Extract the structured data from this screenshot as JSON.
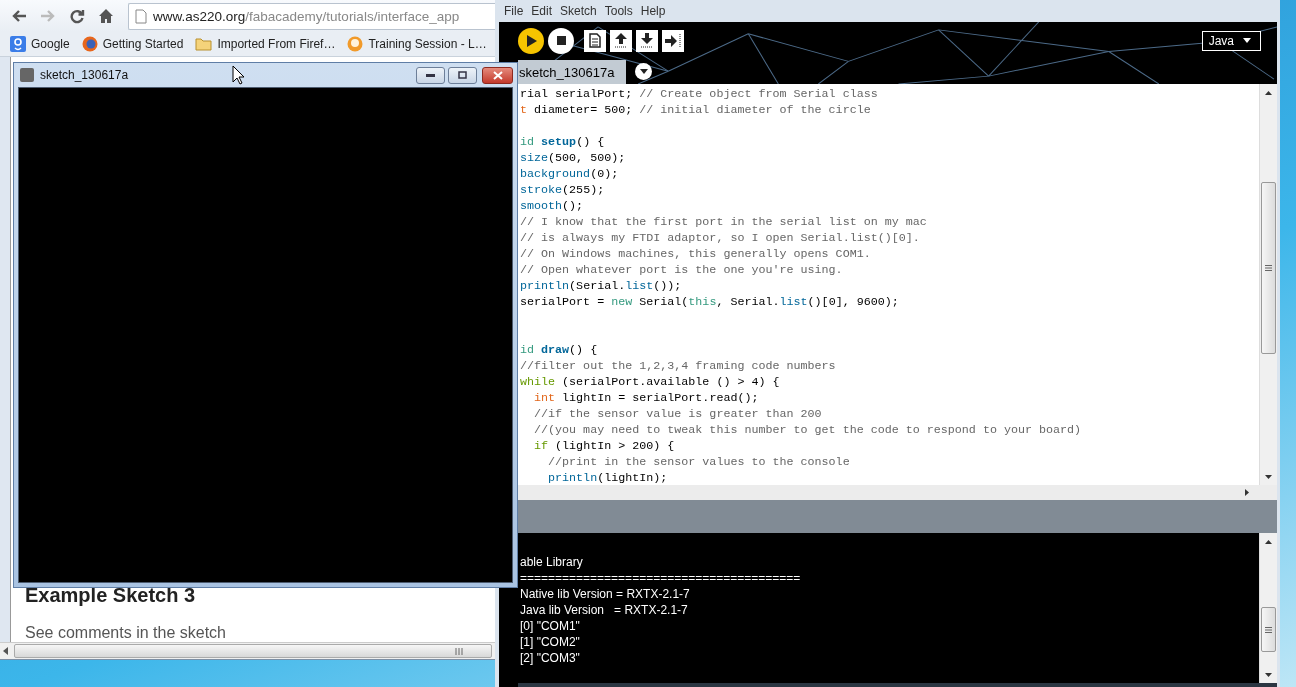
{
  "browser": {
    "nav_buttons": [
      {
        "kind": "back",
        "disabled": false
      },
      {
        "kind": "forward",
        "disabled": true
      },
      {
        "kind": "reload",
        "disabled": false
      },
      {
        "kind": "home",
        "disabled": false
      }
    ],
    "url_host": "www.as220.org",
    "url_path": "/fabacademy/tutorials/interface_app",
    "bookmarks": [
      {
        "kind": "google",
        "label": "Google"
      },
      {
        "kind": "firefox",
        "label": "Getting Started"
      },
      {
        "kind": "folder",
        "label": "Imported From Firef…"
      },
      {
        "kind": "session",
        "label": "Training Session - L…"
      }
    ],
    "page": {
      "heading": "Example Sketch 3",
      "paragraph": "See comments in the sketch"
    }
  },
  "sketch_window": {
    "title": "sketch_130617a"
  },
  "ide": {
    "menu": [
      "File",
      "Edit",
      "Sketch",
      "Tools",
      "Help"
    ],
    "mode": "Java",
    "tabs": [
      {
        "label": "sketch_130617a",
        "selected": true
      }
    ],
    "code": [
      {
        "kind": "code",
        "segs": [
          {
            "t": "rial serialPort; ",
            "kind": "plain"
          },
          {
            "t": "// Create object from Serial class",
            "kind": "comment"
          }
        ]
      },
      {
        "kind": "code",
        "segs": [
          {
            "t": "t",
            "kind": "type"
          },
          {
            "t": " diameter= 500; ",
            "kind": "plain"
          },
          {
            "t": "// initial diameter of the circle",
            "kind": "comment"
          }
        ]
      },
      {
        "kind": "blank"
      },
      {
        "kind": "code",
        "segs": [
          {
            "t": "id ",
            "kind": "kw"
          },
          {
            "t": "setup",
            "kind": "def"
          },
          {
            "t": "() {",
            "kind": "plain"
          }
        ]
      },
      {
        "kind": "code",
        "segs": [
          {
            "t": "size",
            "kind": "fn"
          },
          {
            "t": "(500, 500);",
            "kind": "plain"
          }
        ]
      },
      {
        "kind": "code",
        "segs": [
          {
            "t": "background",
            "kind": "fn"
          },
          {
            "t": "(0);",
            "kind": "plain"
          }
        ]
      },
      {
        "kind": "code",
        "segs": [
          {
            "t": "stroke",
            "kind": "fn"
          },
          {
            "t": "(255);",
            "kind": "plain"
          }
        ]
      },
      {
        "kind": "code",
        "segs": [
          {
            "t": "smooth",
            "kind": "fn"
          },
          {
            "t": "();",
            "kind": "plain"
          }
        ]
      },
      {
        "kind": "code",
        "segs": [
          {
            "t": "// I know that the first port in the serial list on my mac",
            "kind": "comment"
          }
        ]
      },
      {
        "kind": "code",
        "segs": [
          {
            "t": "// is always my FTDI adaptor, so I open Serial.list()[0].",
            "kind": "comment"
          }
        ]
      },
      {
        "kind": "code",
        "segs": [
          {
            "t": "// On Windows machines, this generally opens COM1.",
            "kind": "comment"
          }
        ]
      },
      {
        "kind": "code",
        "segs": [
          {
            "t": "// Open whatever port is the one you're using.",
            "kind": "comment"
          }
        ]
      },
      {
        "kind": "code",
        "segs": [
          {
            "t": "println",
            "kind": "fn"
          },
          {
            "t": "(Serial.",
            "kind": "plain"
          },
          {
            "t": "list",
            "kind": "fn"
          },
          {
            "t": "());",
            "kind": "plain"
          }
        ]
      },
      {
        "kind": "code",
        "segs": [
          {
            "t": "serialPort = ",
            "kind": "plain"
          },
          {
            "t": "new",
            "kind": "kw"
          },
          {
            "t": " Serial(",
            "kind": "plain"
          },
          {
            "t": "this",
            "kind": "kw"
          },
          {
            "t": ", Serial.",
            "kind": "plain"
          },
          {
            "t": "list",
            "kind": "fn"
          },
          {
            "t": "()[0], 9600);",
            "kind": "plain"
          }
        ]
      },
      {
        "kind": "blank"
      },
      {
        "kind": "blank"
      },
      {
        "kind": "code",
        "segs": [
          {
            "t": "id ",
            "kind": "kw"
          },
          {
            "t": "draw",
            "kind": "def"
          },
          {
            "t": "() {",
            "kind": "plain"
          }
        ]
      },
      {
        "kind": "code",
        "segs": [
          {
            "t": "//filter out the 1,2,3,4 framing code numbers",
            "kind": "comment"
          }
        ]
      },
      {
        "kind": "code",
        "segs": [
          {
            "t": "while",
            "kind": "ctrl"
          },
          {
            "t": " (serialPort.available () > 4) {",
            "kind": "plain"
          }
        ]
      },
      {
        "kind": "code",
        "segs": [
          {
            "t": "  int",
            "kind": "type"
          },
          {
            "t": " lightIn = serialPort.read();",
            "kind": "plain"
          }
        ]
      },
      {
        "kind": "code",
        "segs": [
          {
            "t": "  //if the sensor value is greater than 200",
            "kind": "comment"
          }
        ]
      },
      {
        "kind": "code",
        "segs": [
          {
            "t": "  //(you may need to tweak this number to get the code to respond to your board)",
            "kind": "comment"
          }
        ]
      },
      {
        "kind": "code",
        "segs": [
          {
            "t": "  if",
            "kind": "ctrl"
          },
          {
            "t": " (lightIn > 200) {",
            "kind": "plain"
          }
        ]
      },
      {
        "kind": "code",
        "segs": [
          {
            "t": "    //print in the sensor values to the console",
            "kind": "comment"
          }
        ]
      },
      {
        "kind": "code",
        "segs": [
          {
            "t": "    println",
            "kind": "fn"
          },
          {
            "t": "(lightIn);",
            "kind": "plain"
          }
        ]
      }
    ],
    "console": [
      "able Library",
      "========================================",
      "Native lib Version = RXTX-2.1-7",
      "Java lib Version   = RXTX-2.1-7",
      "[0] \"COM1\"",
      "[1] \"COM2\"",
      "[2] \"COM3\""
    ]
  }
}
